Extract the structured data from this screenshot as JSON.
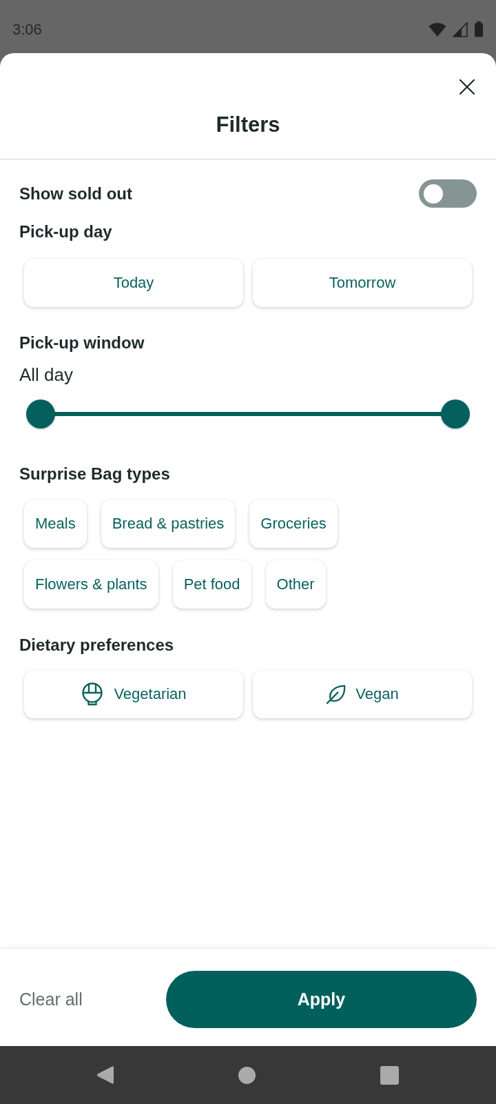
{
  "status_bar": {
    "time": "3:06"
  },
  "sheet": {
    "title": "Filters"
  },
  "show_sold_out": {
    "label": "Show sold out",
    "on": false
  },
  "pickup_day": {
    "heading": "Pick-up day",
    "options": [
      {
        "label": "Today",
        "selected": false
      },
      {
        "label": "Tomorrow",
        "selected": false
      }
    ]
  },
  "pickup_window": {
    "heading": "Pick-up window",
    "value": "All day",
    "range": {
      "start": {
        "level": 0
      },
      "end": {
        "level": 1
      }
    }
  },
  "bag_types": {
    "heading": "Surprise Bag types",
    "options": [
      {
        "label": "Meals",
        "selected": false
      },
      {
        "label": "Bread & pastries",
        "selected": false
      },
      {
        "label": "Groceries",
        "selected": false
      },
      {
        "label": "Flowers & plants",
        "selected": false
      },
      {
        "label": "Pet food",
        "selected": false
      },
      {
        "label": "Other",
        "selected": false
      }
    ]
  },
  "dietary": {
    "heading": "Dietary preferences",
    "options": [
      {
        "label": "Vegetarian",
        "kind": "vegetarian",
        "selected": false
      },
      {
        "label": "Vegan",
        "kind": "vegan",
        "selected": false
      }
    ]
  },
  "footer": {
    "clear": "Clear all",
    "apply": "Apply"
  }
}
